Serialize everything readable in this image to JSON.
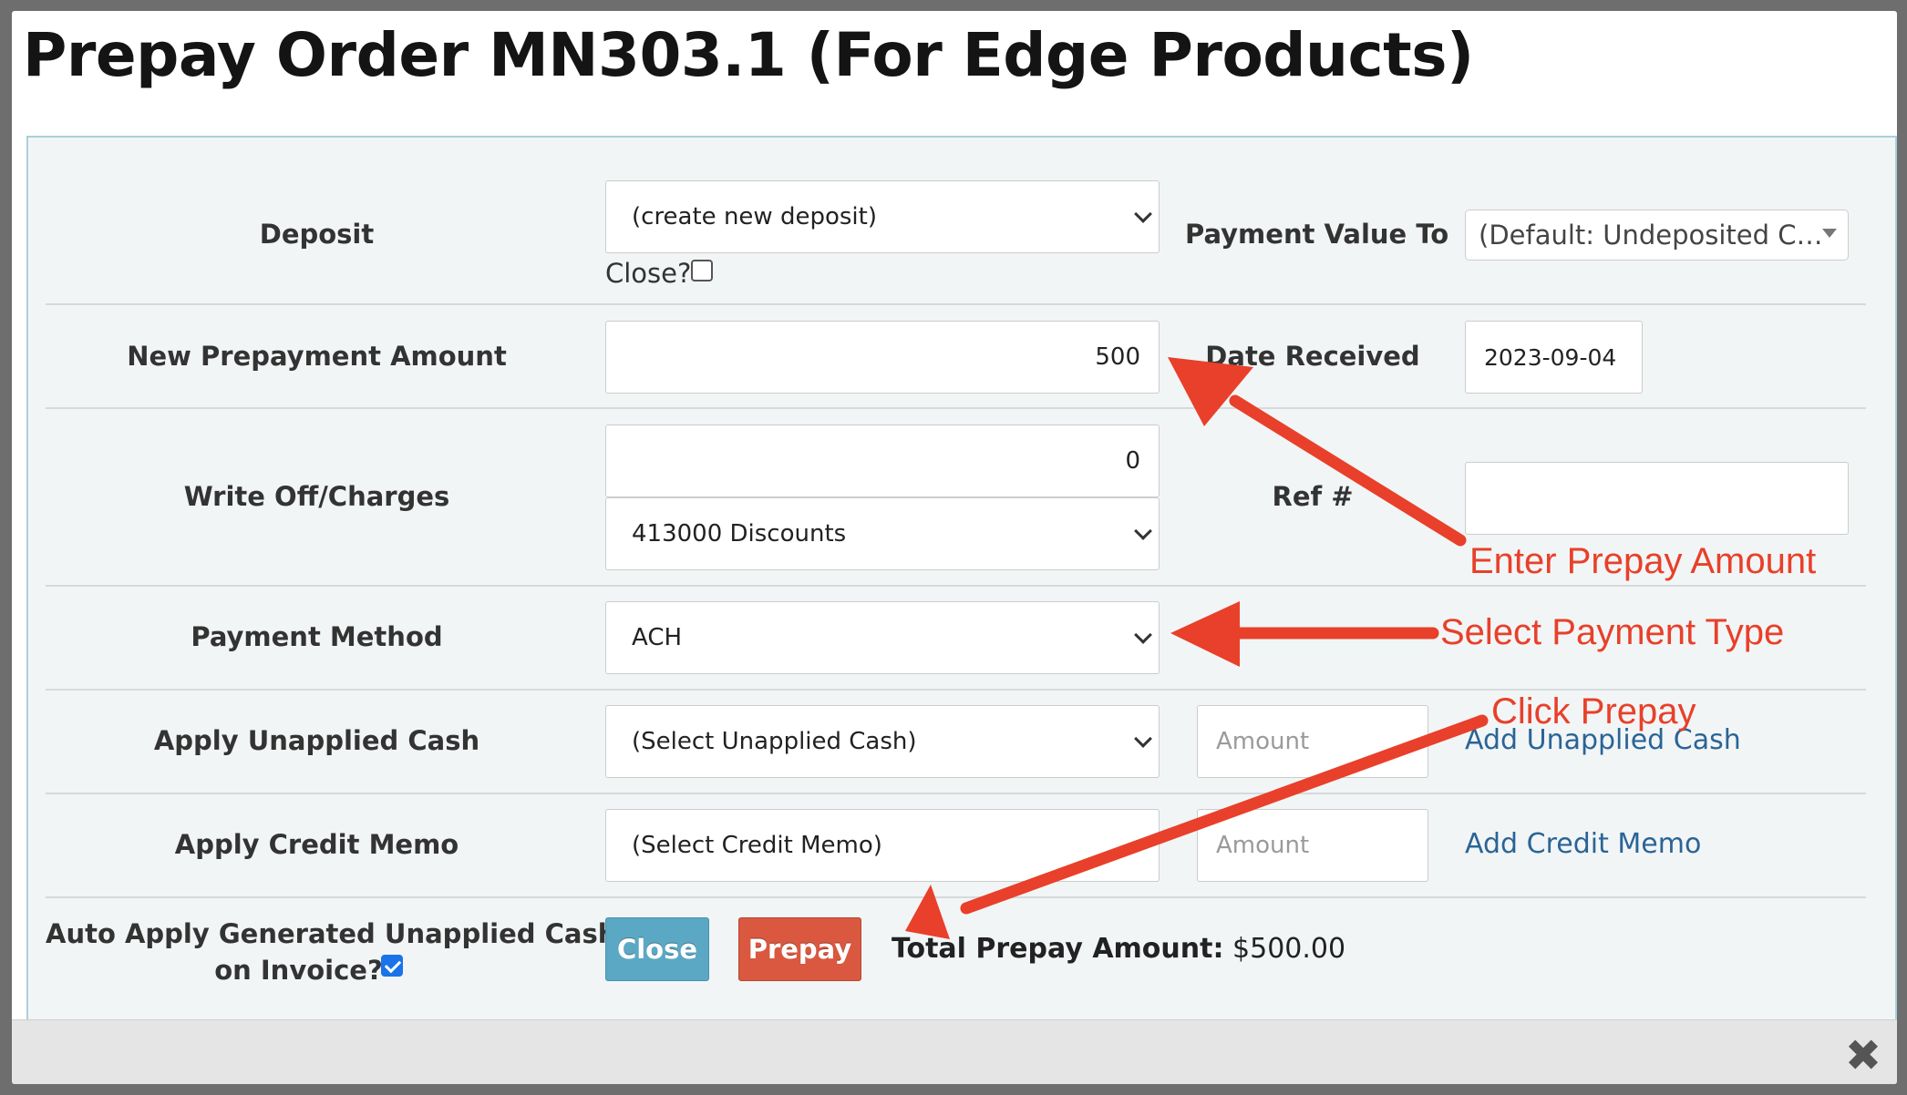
{
  "title": "Prepay Order MN303.1 (For Edge Products)",
  "form": {
    "deposit_label": "Deposit",
    "deposit_value": "(create new deposit)",
    "close_checkbox_label": "Close?",
    "close_checked": false,
    "payment_value_to_label": "Payment Value To",
    "payment_value_to_value": "(Default: Undeposited C…",
    "new_prepayment_label": "New Prepayment Amount",
    "new_prepayment_value": "500",
    "date_received_label": "Date Received",
    "date_received_value": "2023-09-04",
    "write_off_label": "Write Off/Charges",
    "write_off_value": "0",
    "write_off_account": "413000 Discounts",
    "ref_label": "Ref #",
    "ref_value": "",
    "payment_method_label": "Payment Method",
    "payment_method_value": "ACH",
    "apply_unapplied_label": "Apply Unapplied Cash",
    "apply_unapplied_value": "(Select Unapplied Cash)",
    "unapplied_amount_placeholder": "Amount",
    "add_unapplied_link": "Add Unapplied Cash",
    "apply_credit_label": "Apply Credit Memo",
    "apply_credit_value": "(Select Credit Memo)",
    "credit_amount_placeholder": "Amount",
    "add_credit_link": "Add Credit Memo",
    "auto_apply_label_line1": "Auto Apply Generated Unapplied Cash",
    "auto_apply_label_line2": "on Invoice?",
    "auto_apply_checked": true
  },
  "buttons": {
    "close_label": "Close",
    "prepay_label": "Prepay"
  },
  "total": {
    "label": "Total Prepay Amount:",
    "value": "$500.00"
  },
  "annotations": {
    "enter_amount": "Enter Prepay Amount",
    "select_payment": "Select Payment Type",
    "click_prepay": "Click Prepay"
  },
  "colors": {
    "annotation": "#e8402a",
    "close_button": "#5ba8c4",
    "prepay_button": "#d9583f",
    "link": "#2a6496"
  }
}
